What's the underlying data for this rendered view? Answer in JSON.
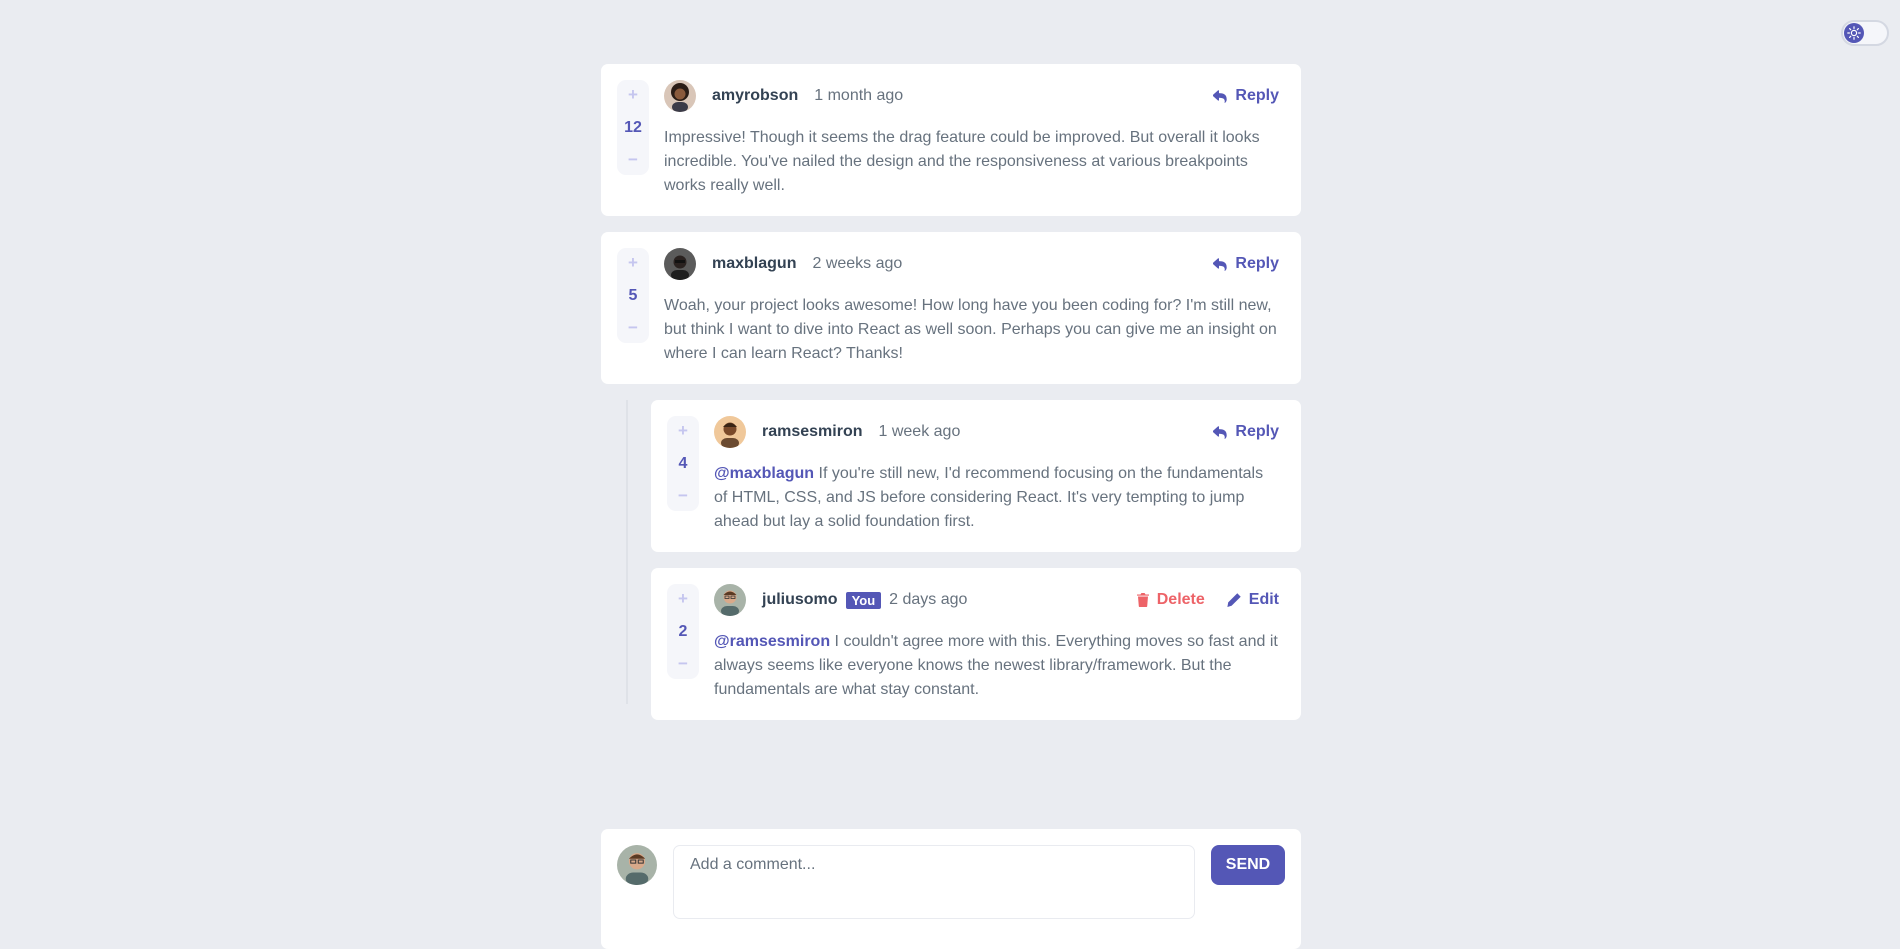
{
  "theme_toggle": {
    "icon": "sun-icon",
    "accent": "#5457b6"
  },
  "colors": {
    "primary": "#5457b6",
    "danger": "#ed6368",
    "background": "#eaecf1"
  },
  "comments": [
    {
      "username": "amyrobson",
      "time": "1 month ago",
      "score": "12",
      "content": "Impressive! Though it seems the drag feature could be improved. But overall it looks incredible. You've nailed the design and the responsiveness at various breakpoints works really well.",
      "action": "Reply"
    },
    {
      "username": "maxblagun",
      "time": "2 weeks ago",
      "score": "5",
      "content": "Woah, your project looks awesome! How long have you been coding for? I'm still new, but think I want to dive into React as well soon. Perhaps you can give me an insight on where I can learn React? Thanks!",
      "action": "Reply"
    }
  ],
  "replies": [
    {
      "username": "ramsesmiron",
      "time": "1 week ago",
      "score": "4",
      "mention": "@maxblagun",
      "content": "If you're still new, I'd recommend focusing on the fundamentals of HTML, CSS, and JS before considering React. It's very tempting to jump ahead but lay a solid foundation first.",
      "action": "Reply"
    },
    {
      "username": "juliusomo",
      "you_badge": "You",
      "time": "2 days ago",
      "score": "2",
      "mention": "@ramsesmiron",
      "content": "I couldn't agree more with this. Everything moves so fast and it always seems like everyone knows the newest library/framework. But the fundamentals are what stay constant.",
      "delete_label": "Delete",
      "edit_label": "Edit"
    }
  ],
  "vote": {
    "plus": "+",
    "minus": "−"
  },
  "composer": {
    "placeholder": "Add a comment...",
    "send_label": "SEND"
  }
}
